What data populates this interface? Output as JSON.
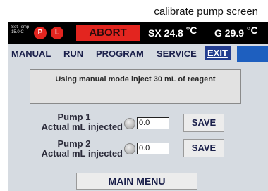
{
  "caption": "calibrate pump screen",
  "status": {
    "set_temp_label": "Set Temp",
    "set_temp_value": "15.0",
    "set_temp_unit": "C",
    "btn_p": "P",
    "btn_l": "L",
    "abort_label": "ABORT",
    "sx_reading": "SX 24.8",
    "g_reading": "G 29.9",
    "degree_unit": "°C"
  },
  "menu": {
    "manual": "MANUAL",
    "run": "RUN",
    "program": "PROGRAM",
    "service": "SERVICE",
    "exit": "EXIT"
  },
  "message": "Using manual mode inject 30 mL of reagent",
  "pumps": [
    {
      "title": "Pump 1",
      "label": "Actual mL injected",
      "value": "0.0",
      "save_label": "SAVE"
    },
    {
      "title": "Pump 2",
      "label": "Actual mL injected",
      "value": "0.0",
      "save_label": "SAVE"
    }
  ],
  "main_menu_label": "MAIN MENU",
  "colors": {
    "abort": "#e3251f",
    "status_bar": "#000000",
    "panel": "#d6dbe1",
    "menu_active": "#233d8f"
  }
}
